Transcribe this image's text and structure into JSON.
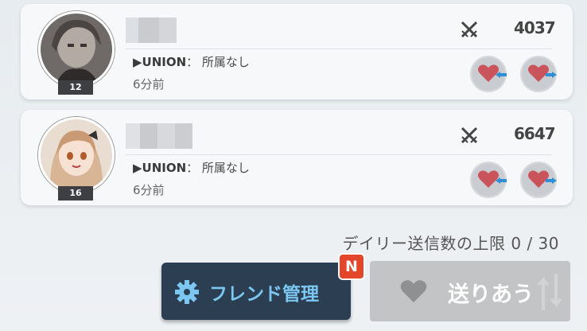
{
  "friends": [
    {
      "level": "12",
      "union_label": "▶UNION",
      "union_value": "： 所属なし",
      "last_seen": "6分前",
      "power": "4037"
    },
    {
      "level": "16",
      "union_label": "▶UNION",
      "union_value": "： 所属なし",
      "last_seen": "6分前",
      "power": "6647"
    }
  ],
  "daily_limit": "デイリー送信数の上限 0 / 30",
  "friend_manage_label": "フレンド管理",
  "new_badge": "N",
  "send_all_label": "送りあう",
  "colors": {
    "primary_button": "#2c3e52",
    "primary_text": "#7cc7f2",
    "badge": "#e3462b",
    "heart": "#c9545c",
    "arrow": "#2f8fd6"
  }
}
